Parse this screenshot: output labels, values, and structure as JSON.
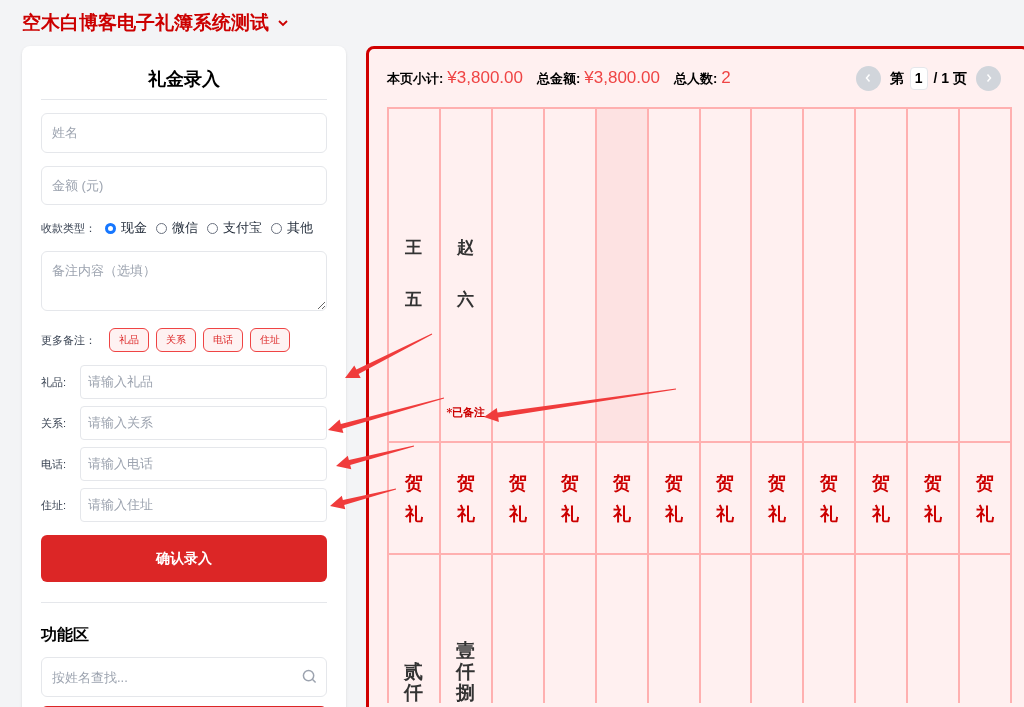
{
  "app": {
    "title": "空木白博客电子礼簿系统测试"
  },
  "entry_form": {
    "heading": "礼金录入",
    "name": {
      "placeholder": "姓名"
    },
    "amount": {
      "placeholder": "金额 (元)"
    },
    "payment_type": {
      "label": "收款类型：",
      "options": [
        {
          "label": "现金",
          "selected": true
        },
        {
          "label": "微信",
          "selected": false
        },
        {
          "label": "支付宝",
          "selected": false
        },
        {
          "label": "其他",
          "selected": false
        }
      ]
    },
    "note": {
      "placeholder": "备注内容（选填）"
    },
    "more_notes": {
      "label": "更多备注：",
      "tags": [
        "礼品",
        "关系",
        "电话",
        "住址"
      ]
    },
    "extra_fields": [
      {
        "label": "礼品:",
        "placeholder": "请输入礼品"
      },
      {
        "label": "关系:",
        "placeholder": "请输入关系"
      },
      {
        "label": "电话:",
        "placeholder": "请输入电话"
      },
      {
        "label": "住址:",
        "placeholder": "请输入住址"
      }
    ],
    "submit": "确认录入"
  },
  "tools": {
    "heading": "功能区",
    "search": {
      "placeholder": "按姓名查找..."
    }
  },
  "ledger": {
    "summary": [
      {
        "label": "本页小计:",
        "value": "¥3,800.00"
      },
      {
        "label": "总金额:",
        "value": "¥3,800.00"
      },
      {
        "label": "总人数:",
        "value": "2"
      }
    ],
    "pagination": {
      "prefix": "第",
      "page": "1",
      "suffix": "/ 1 页"
    },
    "columns": [
      {
        "name": "王五",
        "tag": "贺礼",
        "amount": "贰仟",
        "selected": false
      },
      {
        "name": "赵六",
        "note": "*已备注",
        "tag": "贺礼",
        "amount": "壹仟捌",
        "selected": false
      },
      {
        "tag": "贺礼",
        "selected": false
      },
      {
        "tag": "贺礼",
        "selected": false
      },
      {
        "tag": "贺礼",
        "selected": true
      },
      {
        "tag": "贺礼",
        "selected": false
      },
      {
        "tag": "贺礼",
        "selected": false
      },
      {
        "tag": "贺礼",
        "selected": false
      },
      {
        "tag": "贺礼",
        "selected": false
      },
      {
        "tag": "贺礼",
        "selected": false
      },
      {
        "tag": "贺礼",
        "selected": false
      },
      {
        "tag": "贺礼",
        "selected": false
      }
    ]
  }
}
